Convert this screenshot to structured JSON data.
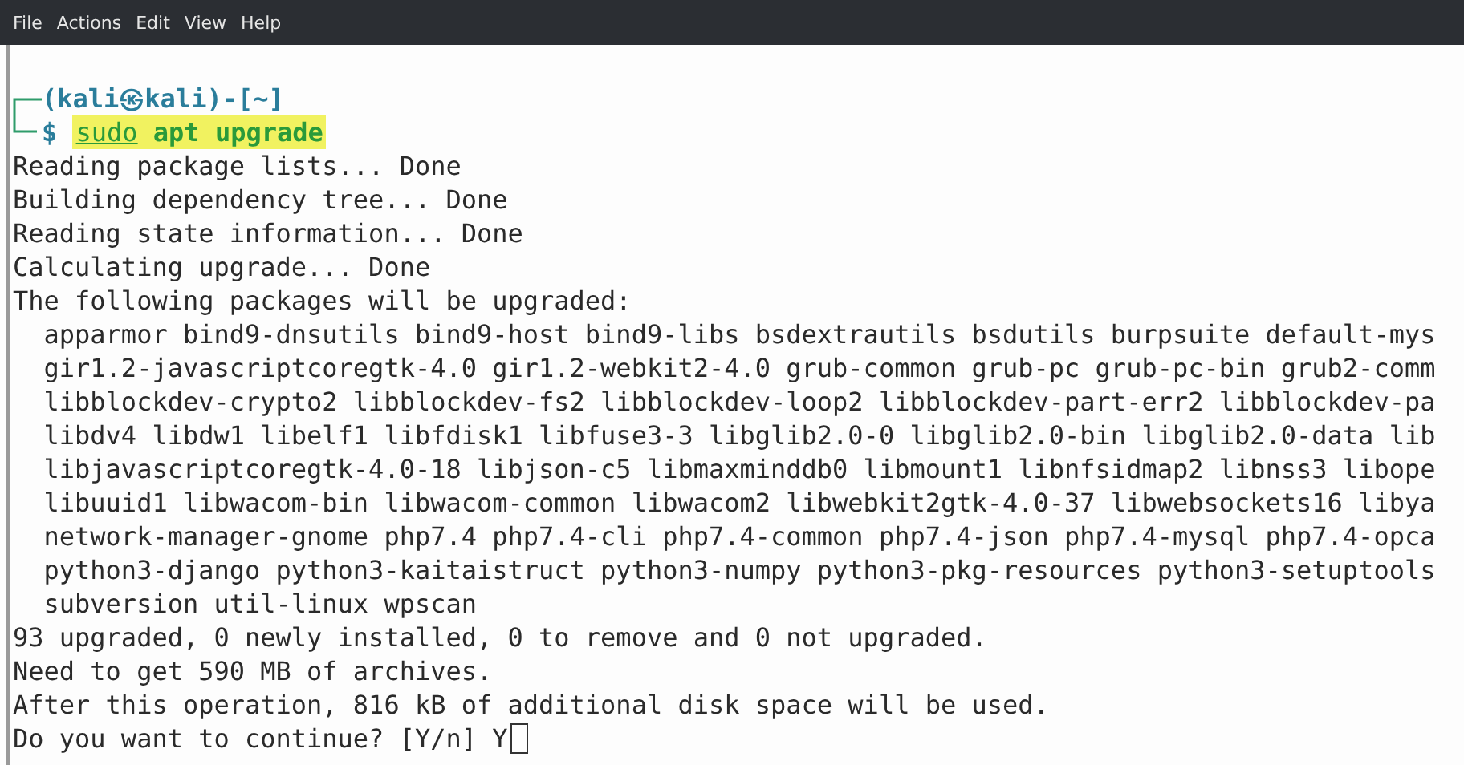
{
  "menu": [
    "File",
    "Actions",
    "Edit",
    "View",
    "Help"
  ],
  "prompt": {
    "text": "(kali㉿kali)-[~]",
    "sign": "$"
  },
  "command": {
    "program": "sudo",
    "args": "apt upgrade",
    "highlighted": true
  },
  "output": [
    "Reading package lists... Done",
    "Building dependency tree... Done",
    "Reading state information... Done",
    "Calculating upgrade... Done",
    "The following packages will be upgraded:",
    "  apparmor bind9-dnsutils bind9-host bind9-libs bsdextrautils bsdutils burpsuite default-mys",
    "  gir1.2-javascriptcoregtk-4.0 gir1.2-webkit2-4.0 grub-common grub-pc grub-pc-bin grub2-comm",
    "  libblockdev-crypto2 libblockdev-fs2 libblockdev-loop2 libblockdev-part-err2 libblockdev-pa",
    "  libdv4 libdw1 libelf1 libfdisk1 libfuse3-3 libglib2.0-0 libglib2.0-bin libglib2.0-data lib",
    "  libjavascriptcoregtk-4.0-18 libjson-c5 libmaxminddb0 libmount1 libnfsidmap2 libnss3 libope",
    "  libuuid1 libwacom-bin libwacom-common libwacom2 libwebkit2gtk-4.0-37 libwebsockets16 libya",
    "  network-manager-gnome php7.4 php7.4-cli php7.4-common php7.4-json php7.4-mysql php7.4-opca",
    "  python3-django python3-kaitaistruct python3-numpy python3-pkg-resources python3-setuptools",
    "  subversion util-linux wpscan",
    "93 upgraded, 0 newly installed, 0 to remove and 0 not upgraded.",
    "Need to get 590 MB of archives.",
    "After this operation, 816 kB of additional disk space will be used."
  ],
  "question": "Do you want to continue? [Y/n]",
  "answer": "Y"
}
